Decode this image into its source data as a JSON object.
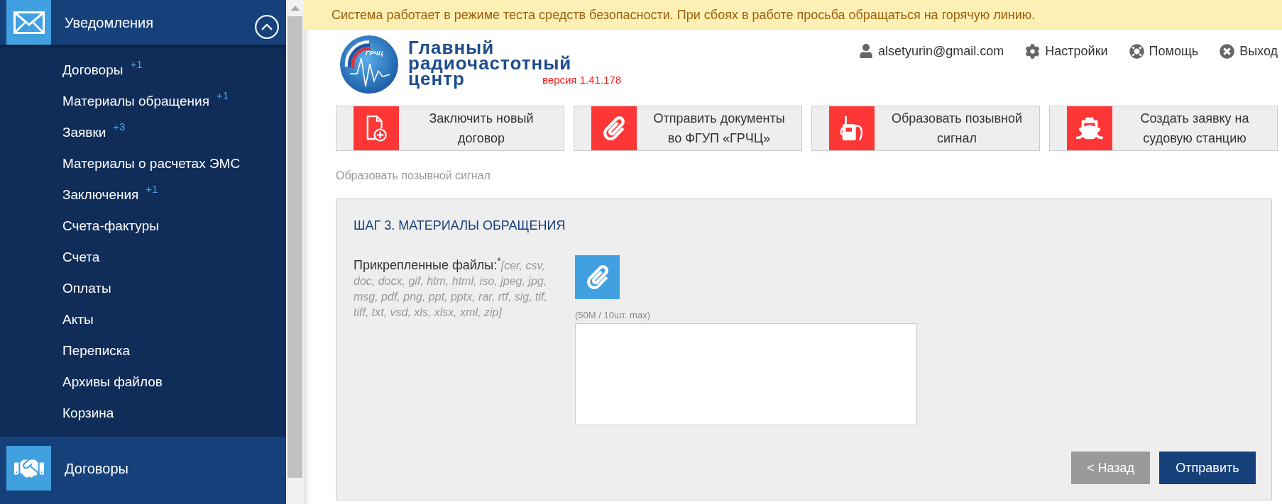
{
  "notice": {
    "text": "Система работает в режиме теста средств безопасности. При сбоях в работе просьба обращаться на горячую линию."
  },
  "sidebar": {
    "sections": [
      {
        "title": "Уведомления",
        "kind": "envelope",
        "expanded": true,
        "items": [
          {
            "label": "Договоры",
            "count": "+1"
          },
          {
            "label": "Материалы обращения",
            "count": "+1"
          },
          {
            "label": "Заявки",
            "count": "+3"
          },
          {
            "label": "Материалы о расчетах ЭМС"
          },
          {
            "label": "Заключения",
            "count": "+1"
          },
          {
            "label": "Счета-фактуры"
          },
          {
            "label": "Счета"
          },
          {
            "label": "Оплаты"
          },
          {
            "label": "Акты"
          },
          {
            "label": "Переписка"
          },
          {
            "label": "Архивы файлов"
          },
          {
            "label": "Корзина"
          }
        ]
      },
      {
        "title": "Договоры",
        "kind": "handshake",
        "expanded": false
      }
    ]
  },
  "header": {
    "logo": {
      "emblem_text": "ГРЧЦ",
      "lines": [
        "Главный",
        "радиочастотный",
        "центр"
      ],
      "version": "версия 1.41.178"
    },
    "user_menu": [
      {
        "kind": "user",
        "label": "alsetyurin@gmail.com"
      },
      {
        "kind": "settings",
        "label": "Настройки"
      },
      {
        "kind": "help",
        "label": "Помощь"
      },
      {
        "kind": "logout",
        "label": "Выход"
      }
    ]
  },
  "actions": [
    {
      "kind": "document-plus",
      "label": "Заключить новый договор"
    },
    {
      "kind": "paperclip",
      "label": "Отправить документы во ФГУП «ГРЧЦ»"
    },
    {
      "kind": "radio",
      "label": "Образовать позывной сигнал"
    },
    {
      "kind": "ship",
      "label": "Создать заявку на судовую станцию"
    }
  ],
  "breadcrumb": "Образовать позывной сигнал",
  "form": {
    "step_title": "ШАГ 3. МАТЕРИАЛЫ ОБРАЩЕНИЯ",
    "attachments": {
      "label": "Прикрепленные файлы:",
      "required_mark": "*",
      "hint": "[cer, csv, doc, docx, gif, htm, html, iso, jpeg, jpg, msg, pdf, png, ppt, pptx, rar, rtf, sig, tif, tiff, txt, vsd, xls, xlsx, xml, zip]",
      "limit": "(50M / 10шт. max)"
    },
    "buttons": [
      {
        "kind": "secondary",
        "label": "< Назад"
      },
      {
        "kind": "primary",
        "label": "Отправить"
      }
    ]
  }
}
